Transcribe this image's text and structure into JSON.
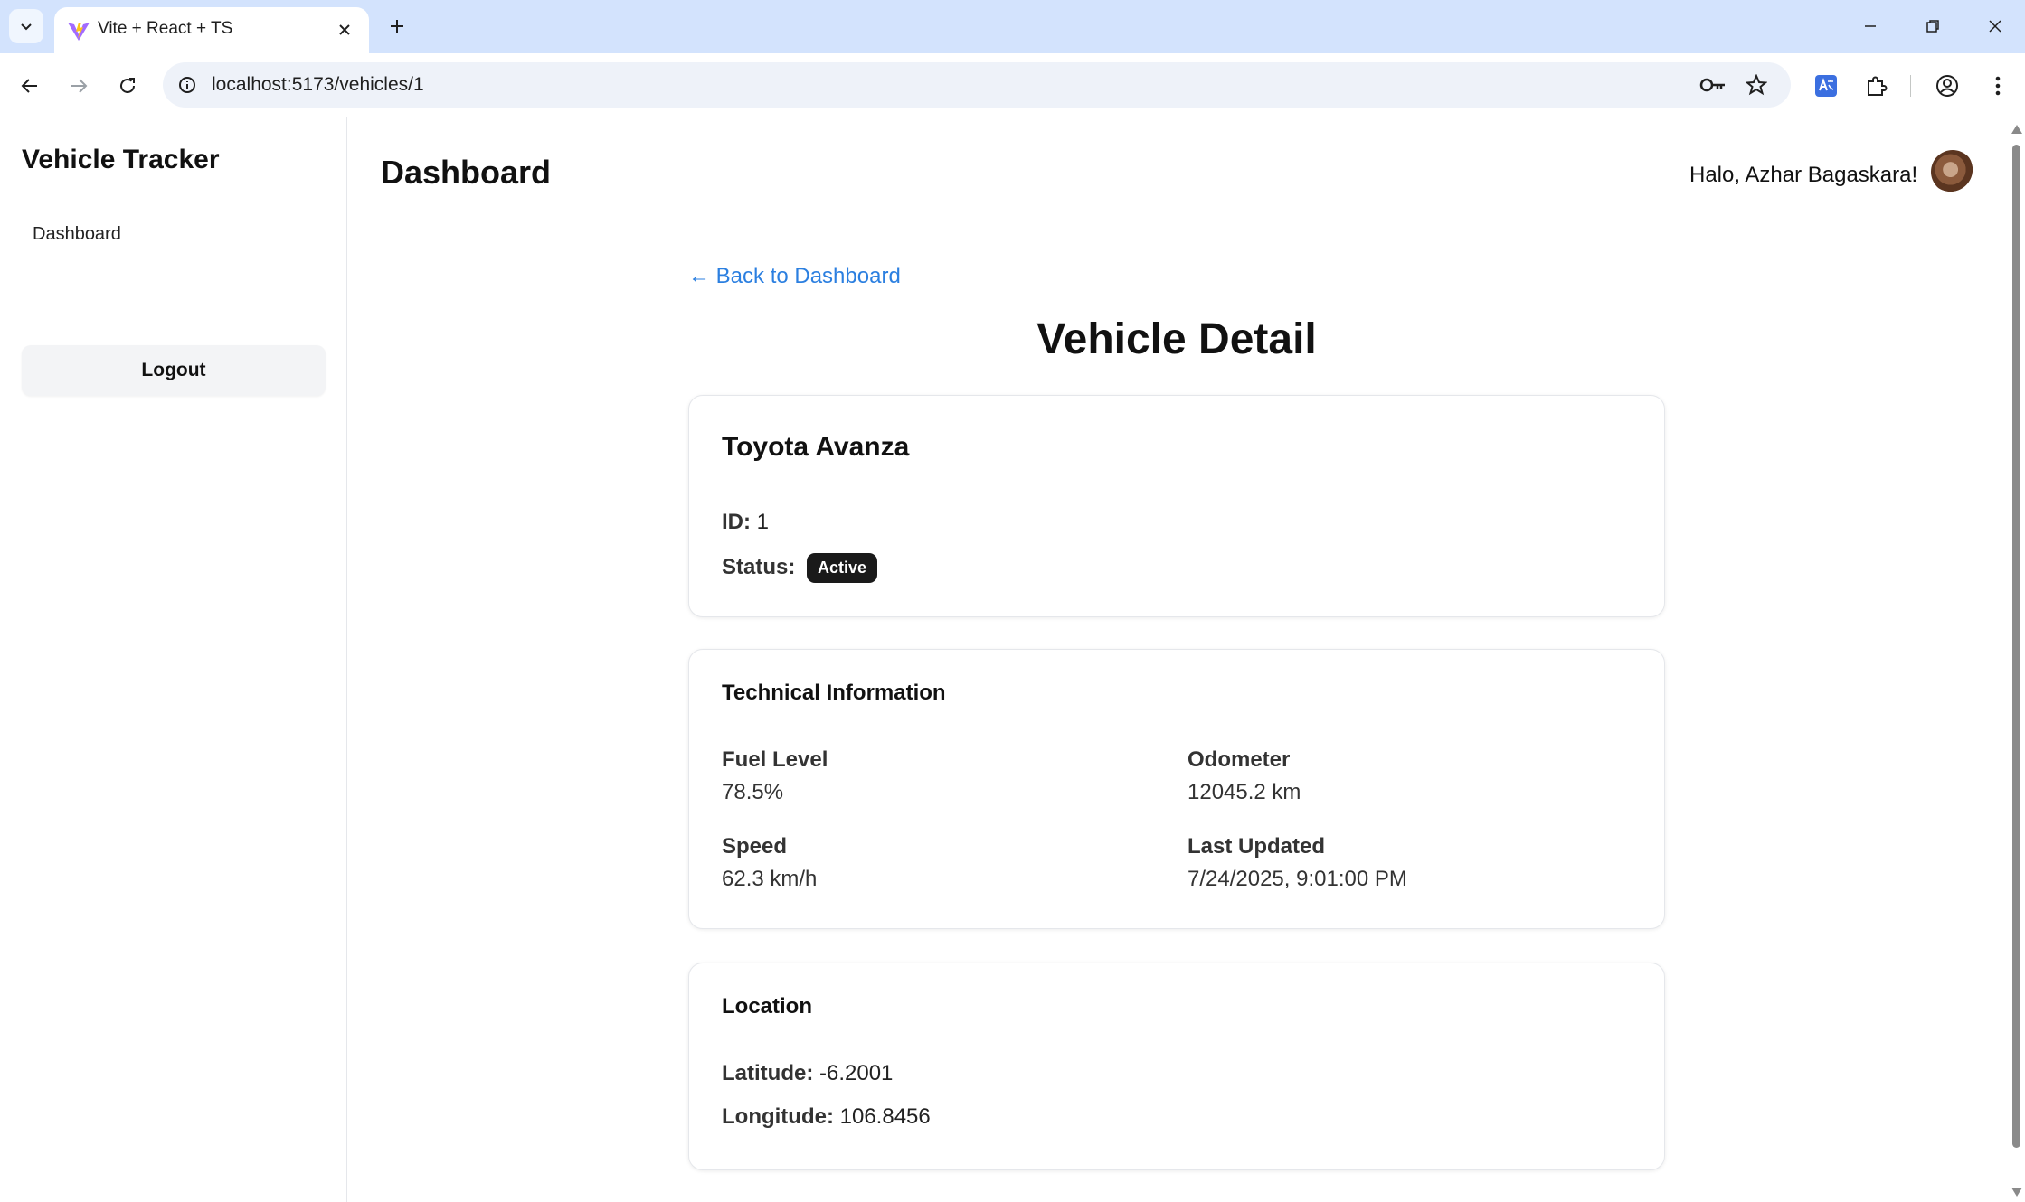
{
  "browser": {
    "tab_title": "Vite + React + TS",
    "url": "localhost:5173/vehicles/1"
  },
  "sidebar": {
    "brand": "Vehicle Tracker",
    "nav": [
      {
        "label": "Dashboard"
      }
    ],
    "logout_label": "Logout"
  },
  "header": {
    "title": "Dashboard",
    "greeting": "Halo, Azhar Bagaskara!"
  },
  "detail": {
    "back_label": "← Back to Dashboard",
    "title": "Vehicle Detail",
    "vehicle_name": "Toyota Avanza",
    "id_label": "ID:",
    "id_value": "1",
    "status_label": "Status:",
    "status_value": "Active"
  },
  "technical": {
    "heading": "Technical Information",
    "fuel_label": "Fuel Level",
    "fuel_value": "78.5%",
    "odometer_label": "Odometer",
    "odometer_value": "12045.2 km",
    "speed_label": "Speed",
    "speed_value": "62.3 km/h",
    "updated_label": "Last Updated",
    "updated_value": "7/24/2025, 9:01:00 PM"
  },
  "location": {
    "heading": "Location",
    "lat_label": "Latitude:",
    "lat_value": "-6.2001",
    "lon_label": "Longitude:",
    "lon_value": "106.8456"
  },
  "colors": {
    "link": "#2b7fe0",
    "badge_bg": "#1a1a1a",
    "tabstrip": "#d3e3fd"
  }
}
